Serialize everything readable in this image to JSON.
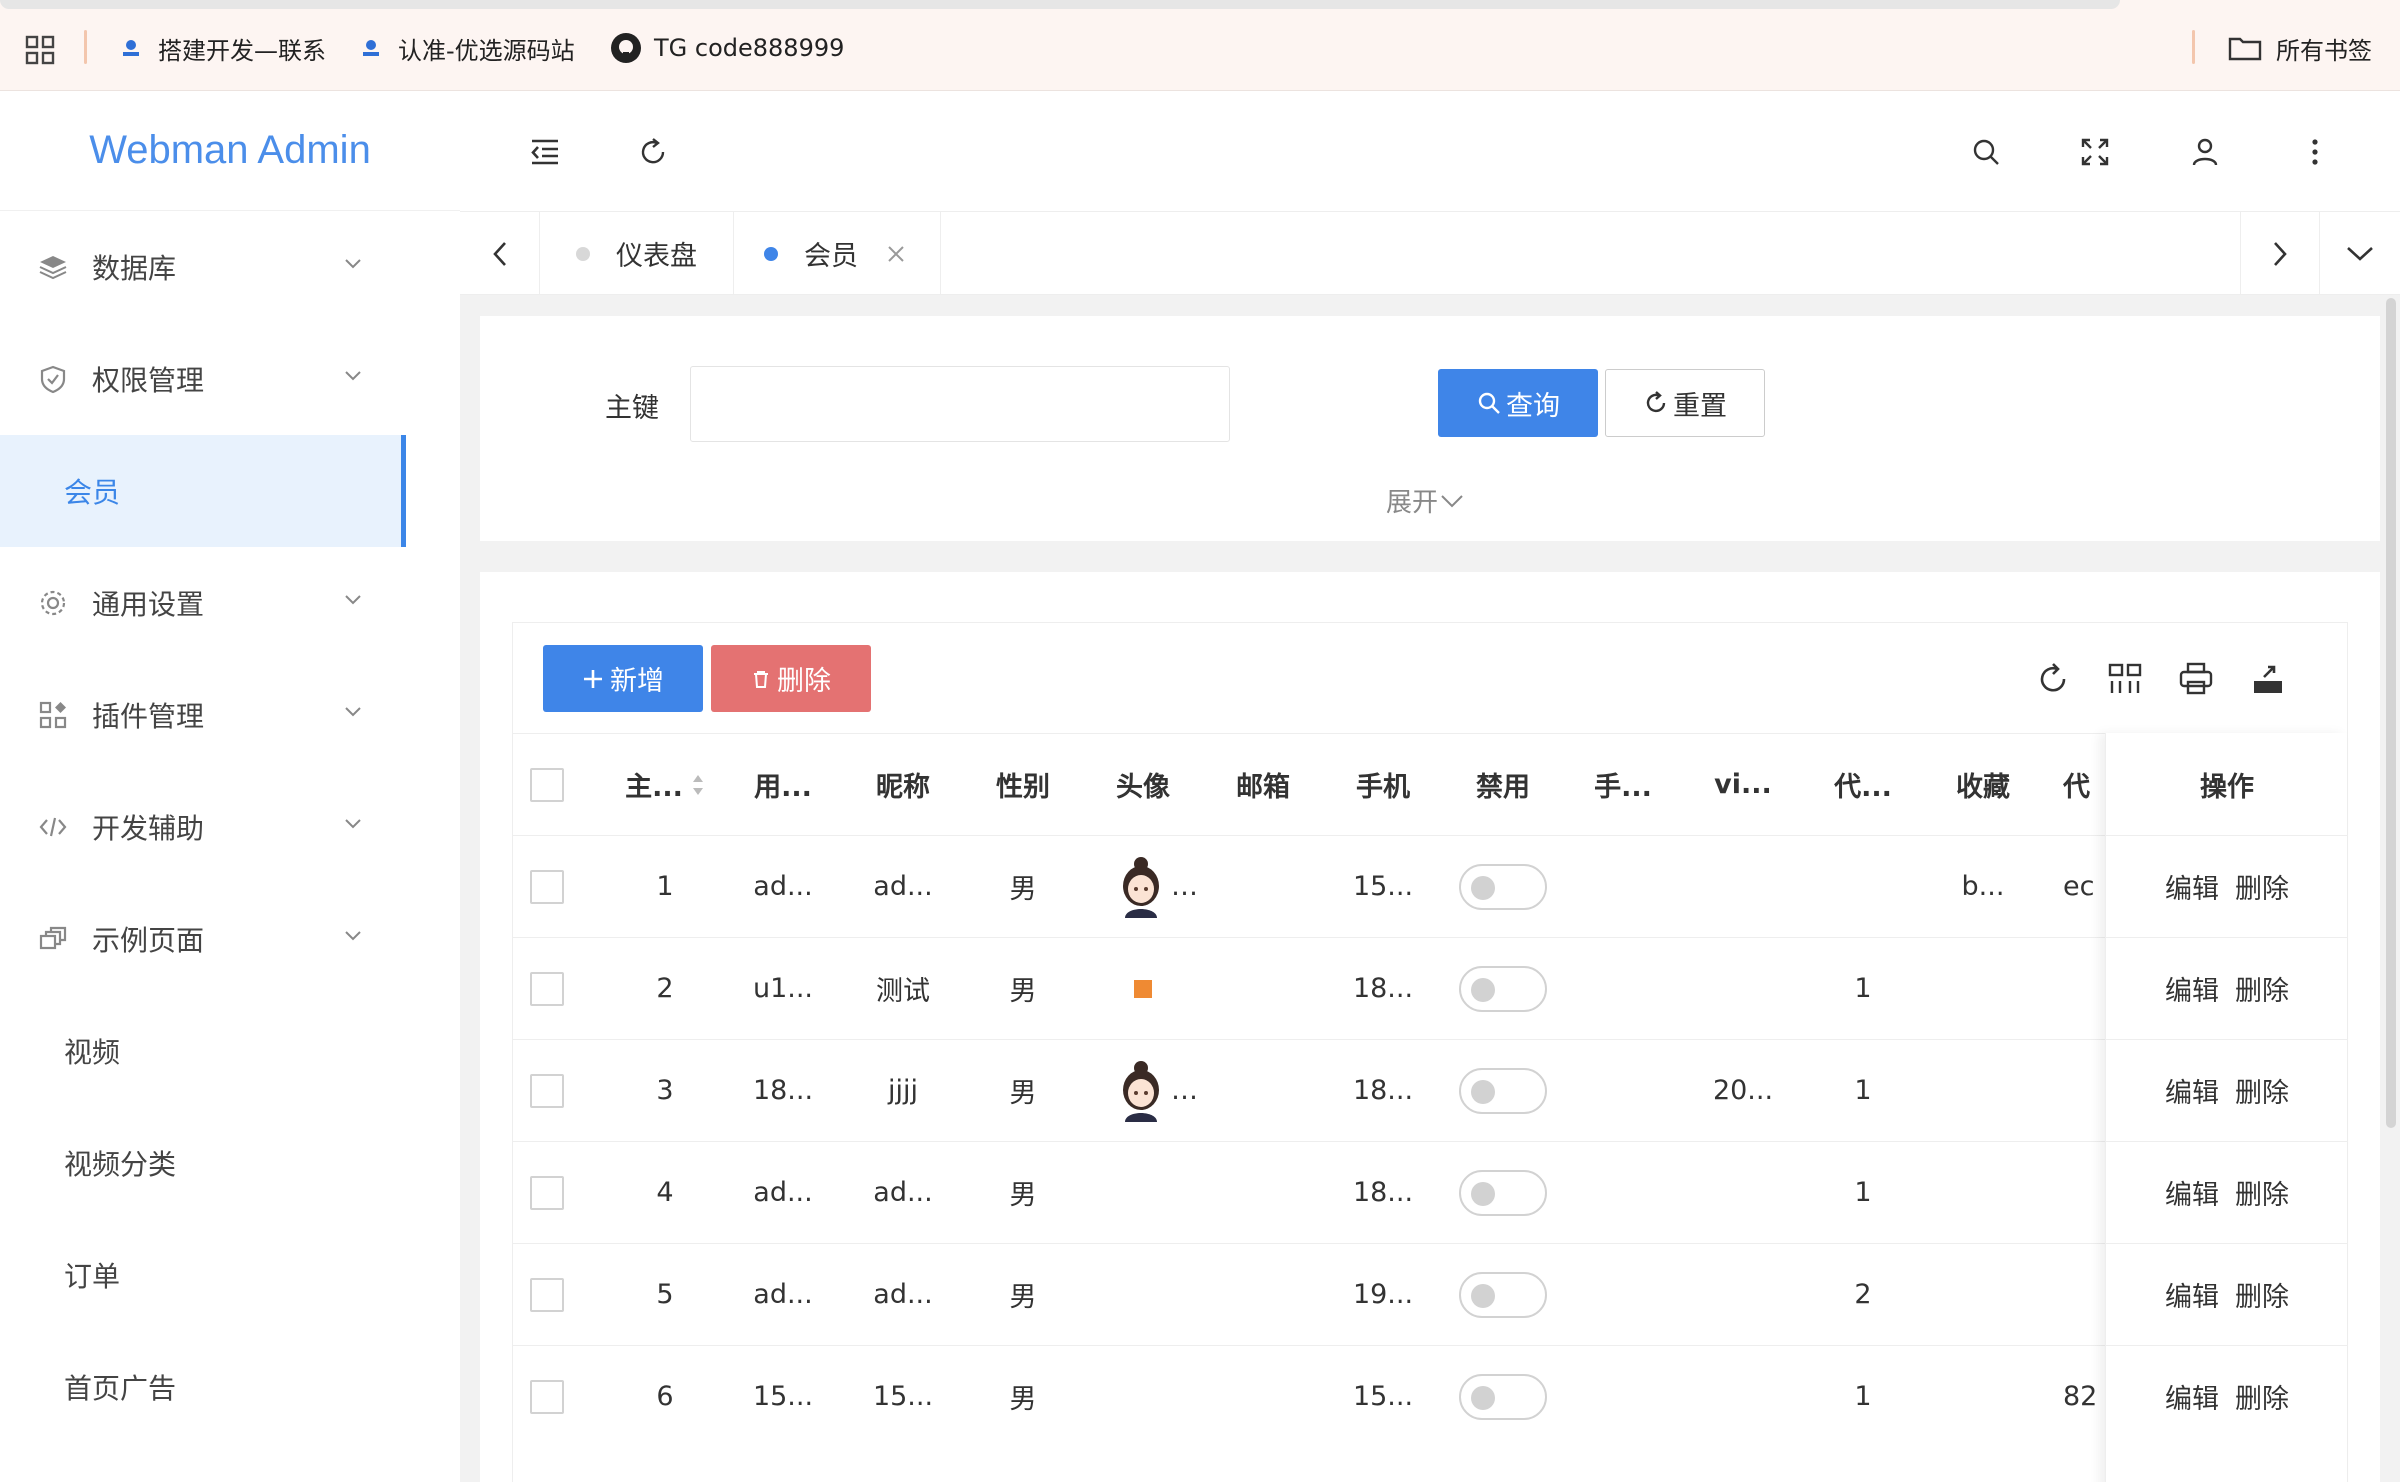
{
  "browser": {
    "bookmarks": [
      {
        "label": "搭建开发—联系"
      },
      {
        "label": "认准-优选源码站"
      },
      {
        "label": "TG code888999"
      }
    ],
    "all_bookmarks": "所有书签"
  },
  "sidebar": {
    "logo": "Webman Admin",
    "items": [
      {
        "label": "数据库",
        "icon": "layers-icon"
      },
      {
        "label": "权限管理",
        "icon": "shield-icon"
      },
      {
        "label": "会员",
        "active": true
      },
      {
        "label": "通用设置",
        "icon": "gear-icon"
      },
      {
        "label": "插件管理",
        "icon": "apps-icon"
      },
      {
        "label": "开发辅助",
        "icon": "code-icon"
      },
      {
        "label": "示例页面",
        "icon": "pages-icon"
      },
      {
        "label": "视频"
      },
      {
        "label": "视频分类"
      },
      {
        "label": "订单"
      },
      {
        "label": "首页广告"
      }
    ]
  },
  "tabs": [
    {
      "label": "仪表盘"
    },
    {
      "label": "会员",
      "active": true
    }
  ],
  "search": {
    "field_label": "主键",
    "query_label": "查询",
    "reset_label": "重置",
    "expand_label": "展开"
  },
  "toolbar": {
    "add_label": "新增",
    "delete_label": "删除"
  },
  "table": {
    "headers": [
      "主...",
      "用...",
      "昵称",
      "性别",
      "头像",
      "邮箱",
      "手机",
      "禁用",
      "手...",
      "vi...",
      "代...",
      "收藏",
      "代"
    ],
    "action_header": "操作",
    "edit_label": "编辑",
    "delete_label": "删除",
    "rows": [
      {
        "id": "1",
        "user": "ad...",
        "nick": "ad...",
        "gender": "男",
        "avatar": "image",
        "email": "",
        "phone": "15...",
        "col9": "",
        "vip": "",
        "agent": "",
        "fav": "b...",
        "last": "ec"
      },
      {
        "id": "2",
        "user": "u1...",
        "nick": "测试",
        "gender": "男",
        "avatar": "orange",
        "email": "",
        "phone": "18...",
        "col9": "",
        "vip": "",
        "agent": "1",
        "fav": "",
        "last": ""
      },
      {
        "id": "3",
        "user": "18...",
        "nick": "jjjj",
        "gender": "男",
        "avatar": "image",
        "email": "",
        "phone": "18...",
        "col9": "",
        "vip": "20...",
        "agent": "1",
        "fav": "",
        "last": ""
      },
      {
        "id": "4",
        "user": "ad...",
        "nick": "ad...",
        "gender": "男",
        "avatar": "",
        "email": "",
        "phone": "18...",
        "col9": "",
        "vip": "",
        "agent": "1",
        "fav": "",
        "last": ""
      },
      {
        "id": "5",
        "user": "ad...",
        "nick": "ad...",
        "gender": "男",
        "avatar": "",
        "email": "",
        "phone": "19...",
        "col9": "",
        "vip": "",
        "agent": "2",
        "fav": "",
        "last": ""
      },
      {
        "id": "6",
        "user": "15...",
        "nick": "15...",
        "gender": "男",
        "avatar": "",
        "email": "",
        "phone": "15...",
        "col9": "",
        "vip": "",
        "agent": "1",
        "fav": "",
        "last": "82"
      }
    ]
  },
  "colors": {
    "primary": "#3f85e8",
    "danger": "#e47272",
    "active_bg": "#e8f2fd"
  }
}
